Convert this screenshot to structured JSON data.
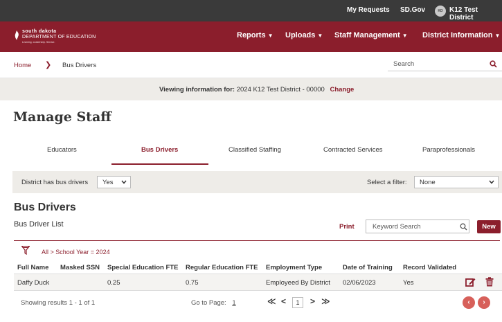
{
  "topbar": {
    "my_requests": "My Requests",
    "sdgov": "SD.Gov",
    "avatar_initials": "KD",
    "district": "K12 Test District"
  },
  "logo": {
    "line1": "south dakota",
    "line2": "DEPARTMENT OF EDUCATION",
    "line3": "Learning. Leadership. Service."
  },
  "nav": {
    "items": [
      {
        "label": "Reports"
      },
      {
        "label": "Uploads"
      },
      {
        "label": "Staff Management"
      },
      {
        "label": "District Information"
      }
    ]
  },
  "breadcrumb": {
    "home": "Home",
    "separator": "❯",
    "current": "Bus Drivers"
  },
  "search": {
    "placeholder": "Search"
  },
  "viewing": {
    "label": "Viewing information for:",
    "value": "2024 K12 Test District - 00000",
    "change": "Change"
  },
  "page_title": "Manage Staff",
  "tabs": [
    {
      "label": "Educators"
    },
    {
      "label": "Bus Drivers"
    },
    {
      "label": "Classified Staffing"
    },
    {
      "label": "Contracted Services"
    },
    {
      "label": "Paraprofessionals"
    }
  ],
  "filterbar": {
    "has_label": "District has bus drivers",
    "has_value": "Yes",
    "filter_label": "Select a filter:",
    "filter_value": "None"
  },
  "section": {
    "title": "Bus Drivers",
    "list_title": "Bus Driver List",
    "print": "Print",
    "keyword_placeholder": "Keyword Search",
    "new": "New"
  },
  "filter_breadcrumb": "All > School Year = 2024",
  "table": {
    "columns": [
      "Full Name",
      "Masked SSN",
      "Special Education FTE",
      "Regular Education FTE",
      "Employment Type",
      "Date of Training",
      "Record Validated"
    ],
    "rows": [
      {
        "full_name": "Daffy Duck",
        "masked_ssn": "",
        "sped_fte": "0.25",
        "reg_fte": "0.75",
        "employment_type": "Employeed By District",
        "date_of_training": "02/06/2023",
        "record_validated": "Yes"
      }
    ]
  },
  "pager": {
    "showing": "Showing results 1 - 1 of 1",
    "goto_label": "Go to Page:",
    "goto_value": "1",
    "first": "≪",
    "prev": "<",
    "current": "1",
    "next": ">",
    "last": "≫",
    "prev_circle": "‹",
    "next_circle": "›"
  },
  "colors": {
    "brand": "#8b1e2c",
    "topbar": "#3a3a3a",
    "band": "#eeece8",
    "pager_circle": "#d7605a"
  }
}
